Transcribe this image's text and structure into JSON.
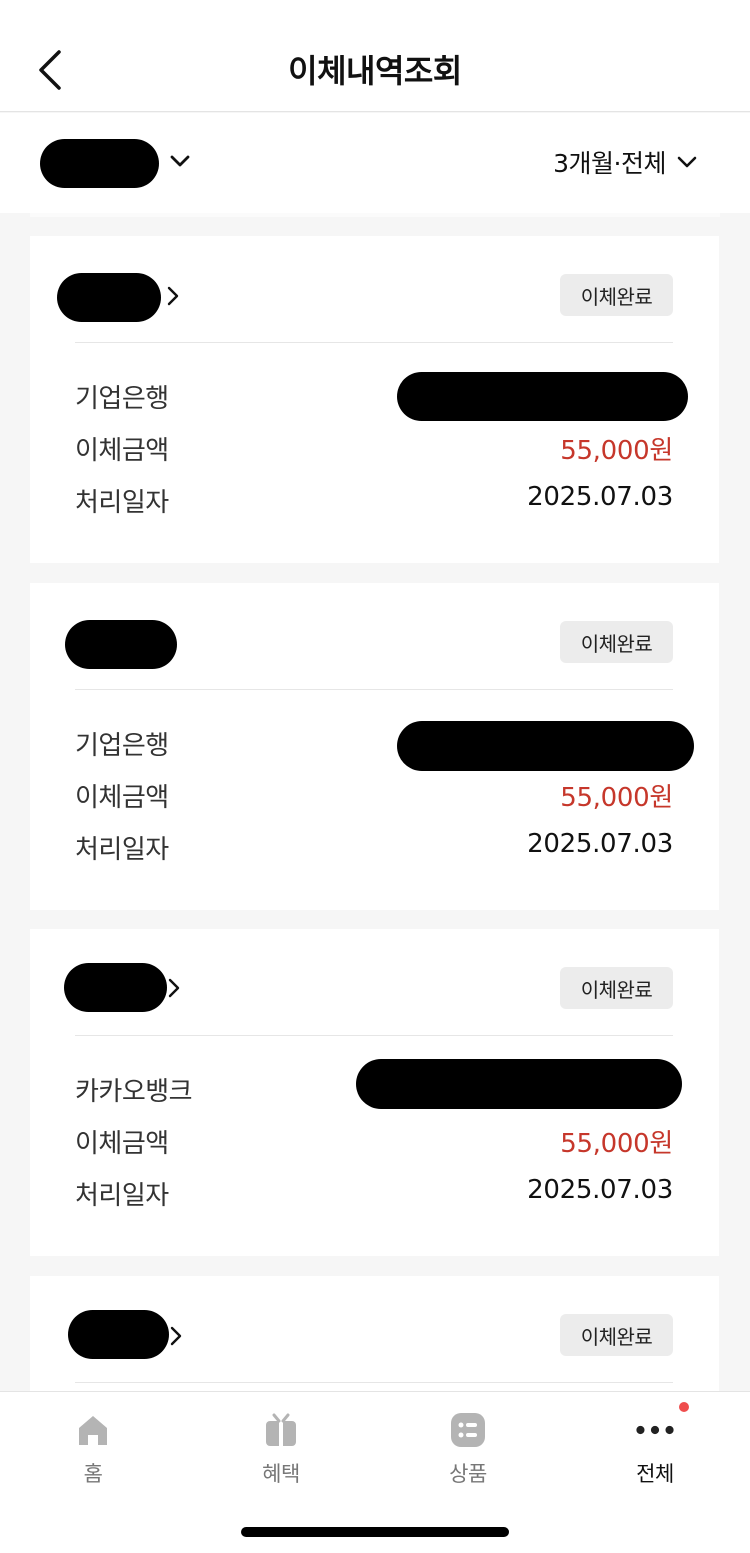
{
  "header": {
    "title": "이체내역조회"
  },
  "filter": {
    "period_label": "3개월·전체"
  },
  "transfers": [
    {
      "status": "이체완료",
      "bank_label": "기업은행",
      "amount_label": "이체금액",
      "amount": "55,000원",
      "date_label": "처리일자",
      "date": "2025.07.03"
    },
    {
      "status": "이체완료",
      "bank_label": "기업은행",
      "amount_label": "이체금액",
      "amount": "55,000원",
      "date_label": "처리일자",
      "date": "2025.07.03"
    },
    {
      "status": "이체완료",
      "bank_label": "카카오뱅크",
      "amount_label": "이체금액",
      "amount": "55,000원",
      "date_label": "처리일자",
      "date": "2025.07.03"
    },
    {
      "status": "이체완료"
    }
  ],
  "tabbar": {
    "items": [
      {
        "label": "홈",
        "icon": "home-icon"
      },
      {
        "label": "혜택",
        "icon": "gift-icon"
      },
      {
        "label": "상품",
        "icon": "product-list-icon"
      },
      {
        "label": "전체",
        "icon": "more-dots-icon"
      }
    ],
    "accent": "#ef4d4d"
  },
  "colors": {
    "amount": "#c6372b",
    "badge_bg": "#ececec"
  }
}
